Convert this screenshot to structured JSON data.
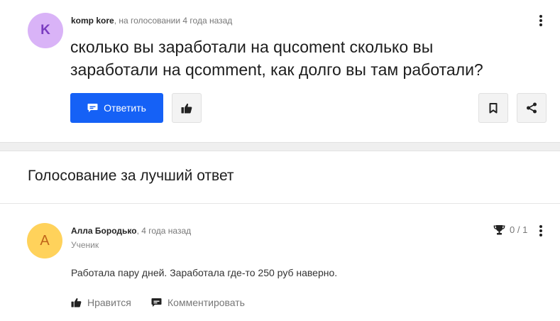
{
  "question": {
    "avatar_letter": "K",
    "author": "komp kore",
    "meta": ", на голосовании 4 года назад",
    "text": "сколько вы заработали на qucoment сколько вы заработали на qcomment, как долго вы там работали?",
    "answer_button": "Ответить",
    "icons": [
      "chat-icon",
      "thumb-up-icon",
      "bookmark-icon",
      "share-icon",
      "more-icon"
    ]
  },
  "vote_title": "Голосование за лучший ответ",
  "answer": {
    "avatar_letter": "А",
    "author": "Алла Бородько",
    "meta": ", 4 года назад",
    "rank": "Ученик",
    "votes": "0 / 1",
    "text": "Работала пару дней. Заработала где-то 250 руб наверно.",
    "like_label": "Нравится",
    "comment_label": "Комментировать"
  },
  "colors": {
    "accent": "#1561f6",
    "question_avatar_bg": "#d9b3f7",
    "answer_avatar_bg": "#ffd25b"
  }
}
